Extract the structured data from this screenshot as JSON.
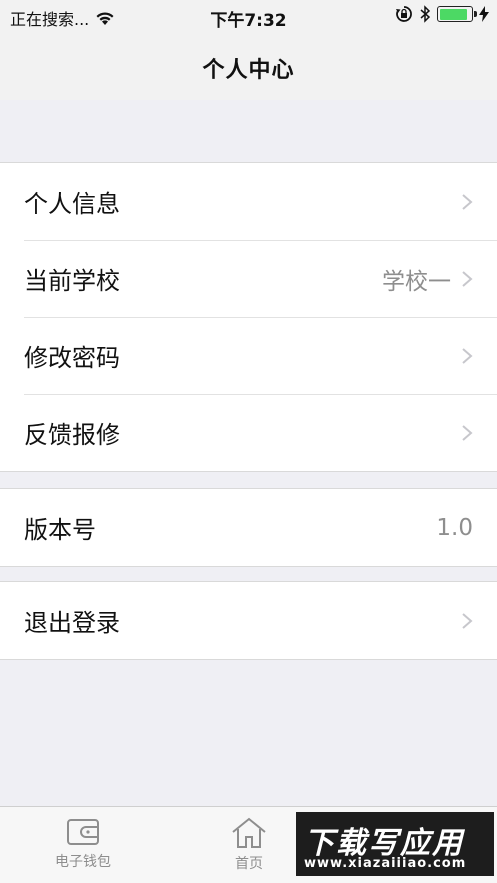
{
  "status_bar": {
    "carrier": "正在搜索...",
    "time": "下午7:32",
    "battery_level": 0.9,
    "colors": {
      "battery": "#4cd964"
    },
    "icons": [
      "wifi-icon",
      "rotation-lock-icon",
      "bluetooth-icon",
      "battery-icon",
      "charging-icon"
    ]
  },
  "nav": {
    "title": "个人中心"
  },
  "groups": [
    {
      "rows": [
        {
          "label": "个人信息",
          "value": "",
          "chevron": true
        },
        {
          "label": "当前学校",
          "value": "学校一",
          "chevron": true
        },
        {
          "label": "修改密码",
          "value": "",
          "chevron": true
        },
        {
          "label": "反馈报修",
          "value": "",
          "chevron": true
        }
      ]
    },
    {
      "rows": [
        {
          "label": "版本号",
          "value": "1.0",
          "chevron": false
        }
      ]
    },
    {
      "rows": [
        {
          "label": "退出登录",
          "value": "",
          "chevron": true
        }
      ]
    }
  ],
  "tab_bar": {
    "tabs": [
      {
        "label": "电子钱包",
        "icon": "wallet-icon"
      },
      {
        "label": "首页",
        "icon": "home-icon"
      },
      {
        "label": "",
        "icon": "profile-icon"
      }
    ]
  },
  "watermark": {
    "top": "下载写应用",
    "bottom": "www.xiazaiiiao.com"
  }
}
